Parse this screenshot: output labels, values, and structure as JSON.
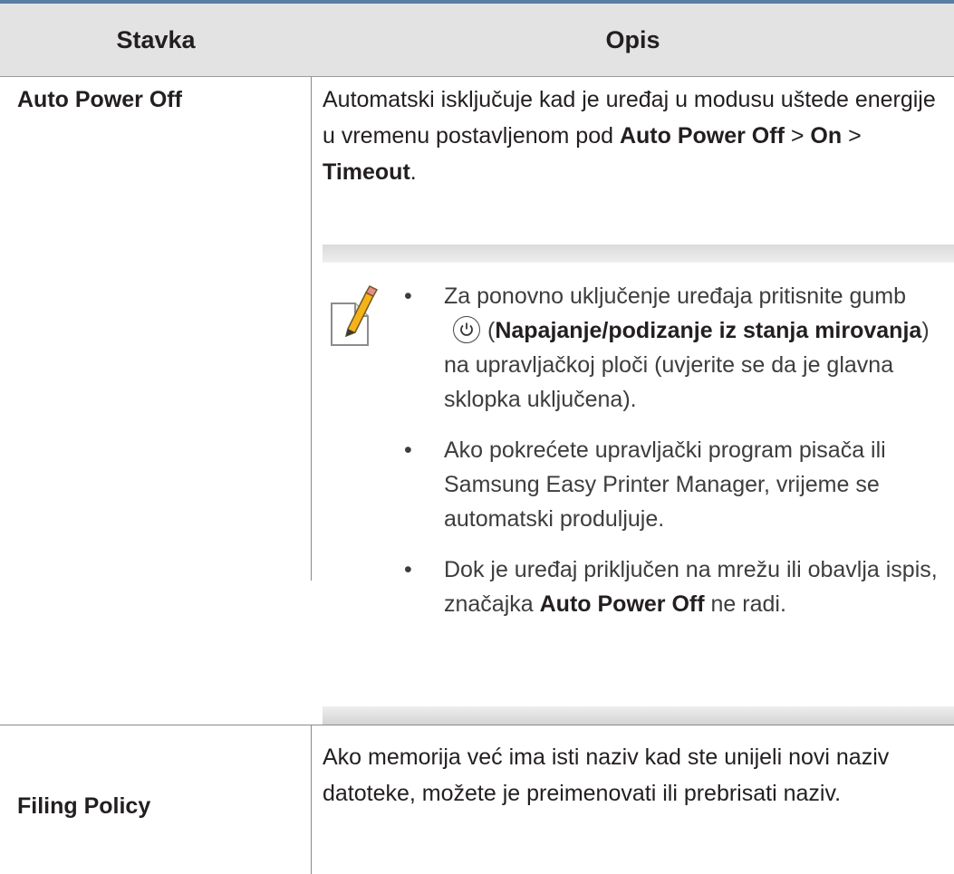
{
  "header": {
    "col_item": "Stavka",
    "col_desc": "Opis"
  },
  "rows": [
    {
      "term": "Auto Power Off",
      "desc_parts": [
        "Automatski isključuje kad je uređaj u modusu uštede energije u vremenu postavljenom pod ",
        "Auto Power Off",
        " > ",
        "On",
        " > ",
        "Timeout",
        "."
      ],
      "note": {
        "icon": "note-pencil-icon",
        "items": [
          {
            "parts": [
              "Za ponovno uključenje uređaja pritisnite gumb ",
              "(",
              "Napajanje/podizanje iz stanja mirovanja",
              ") na upravljačkoj ploči (uvjerite se da je glavna sklopka uključena)."
            ],
            "inline_icon": "power-icon"
          },
          {
            "parts": [
              "Ako pokrećete upravljački program pisača ili Samsung Easy Printer Manager, vrijeme se automatski produljuje."
            ]
          },
          {
            "parts": [
              "Dok je uređaj priključen na mrežu ili obavlja ispis, značajka ",
              "Auto Power Off",
              " ne radi."
            ]
          }
        ]
      }
    },
    {
      "term": "Filing Policy",
      "desc": "Ako memorija već ima isti naziv kad ste unijeli novi naziv datoteke, možete je preimenovati ili prebrisati naziv."
    }
  ],
  "colors": {
    "header_bg": "#e3e3e3",
    "top_rule": "#5a7ea3",
    "icon_accent": "#f5b21a"
  }
}
